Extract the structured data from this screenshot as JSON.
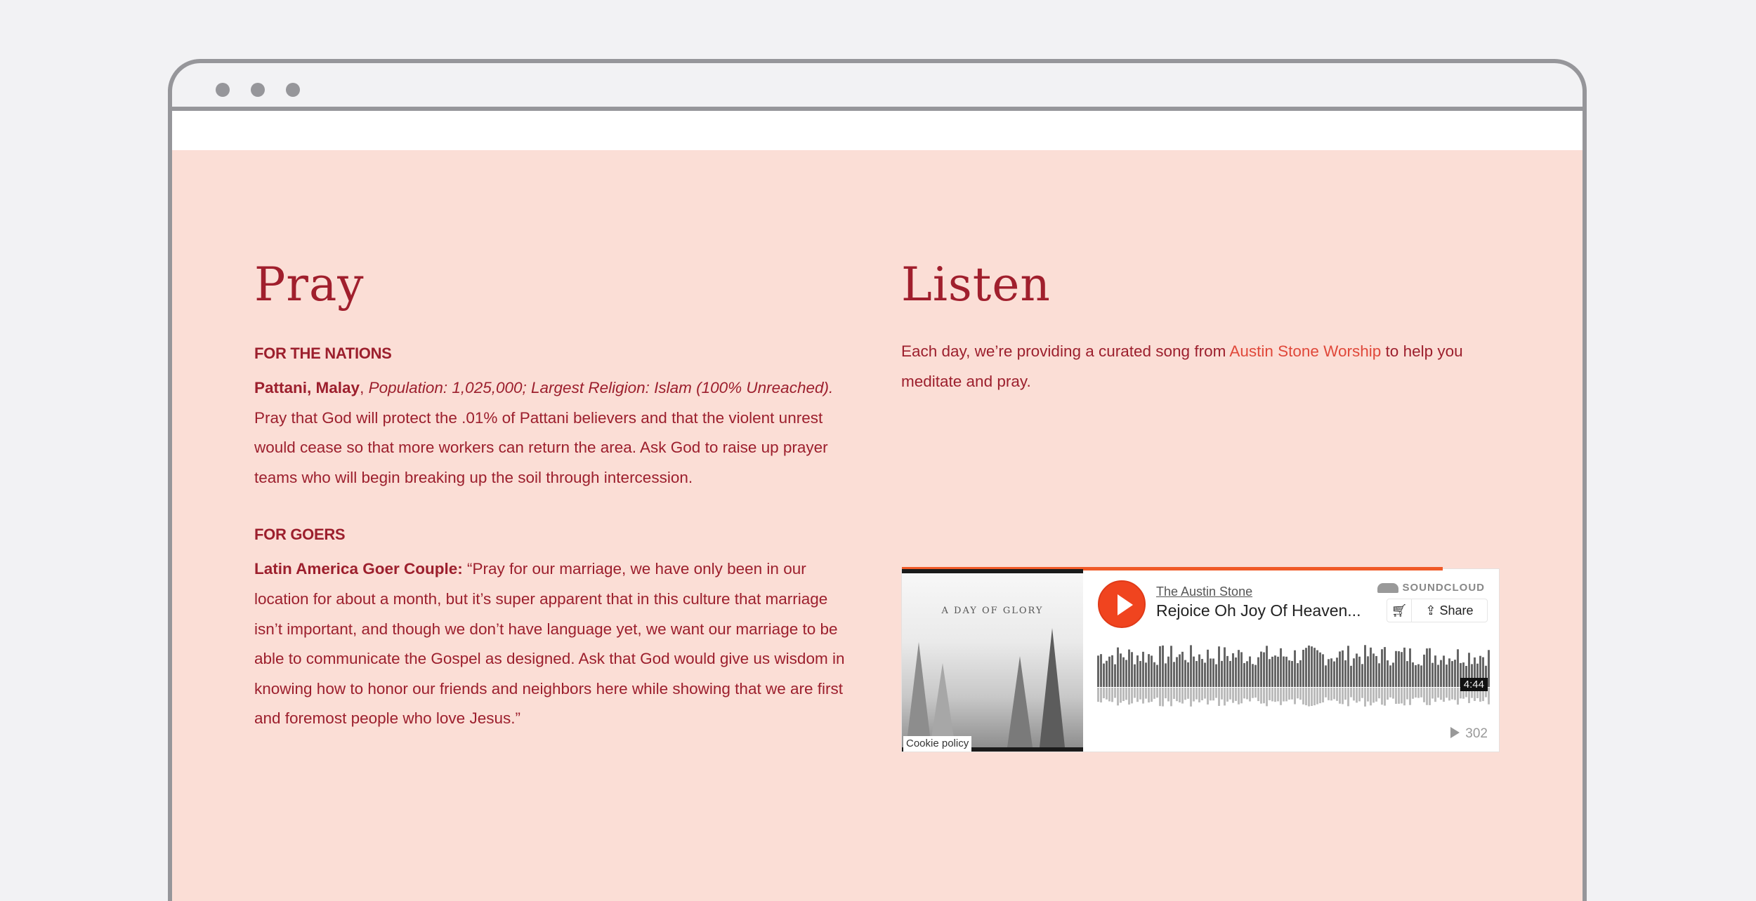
{
  "pray": {
    "heading": "Pray",
    "nations_label": "FOR THE NATIONS",
    "nations_name": "Pattani, Malay",
    "nations_comma": ", ",
    "nations_stats": "Population: 1,025,000; Largest Religion: Islam (100% Unreached).",
    "nations_text": " Pray that God will protect the .01% of Pattani believers and that the violent unrest would cease so that more workers can return the area. Ask God to raise up prayer teams who will begin breaking up the soil through intercession.",
    "goers_label": "FOR GOERS",
    "goers_name": "Latin America Goer Couple:",
    "goers_text": " “Pray for our marriage, we have only been in our location for about a month, but it’s super apparent that in this culture that marriage isn’t important, and though we don’t have language yet, we want our marriage to be able to communicate the Gospel as designed. Ask that God would give us wisdom in knowing how to honor our friends and neighbors here while showing that we are first and foremost people who love Jesus.”"
  },
  "listen": {
    "heading": "Listen",
    "intro_before": "Each day, we’re providing a curated song from ",
    "intro_link": "Austin Stone Worship",
    "intro_after": " to help you meditate and pray."
  },
  "player": {
    "artist": "The Austin Stone",
    "track": "Rejoice Oh Joy Of Heaven...",
    "brand": "SOUNDCLOUD",
    "share_label": "Share",
    "cart_icon": "cart-icon",
    "duration": "4:44",
    "plays": "302",
    "cookie_label": "Cookie policy",
    "art_title": "A DAY OF GLORY",
    "accent_color": "#f05a28"
  }
}
